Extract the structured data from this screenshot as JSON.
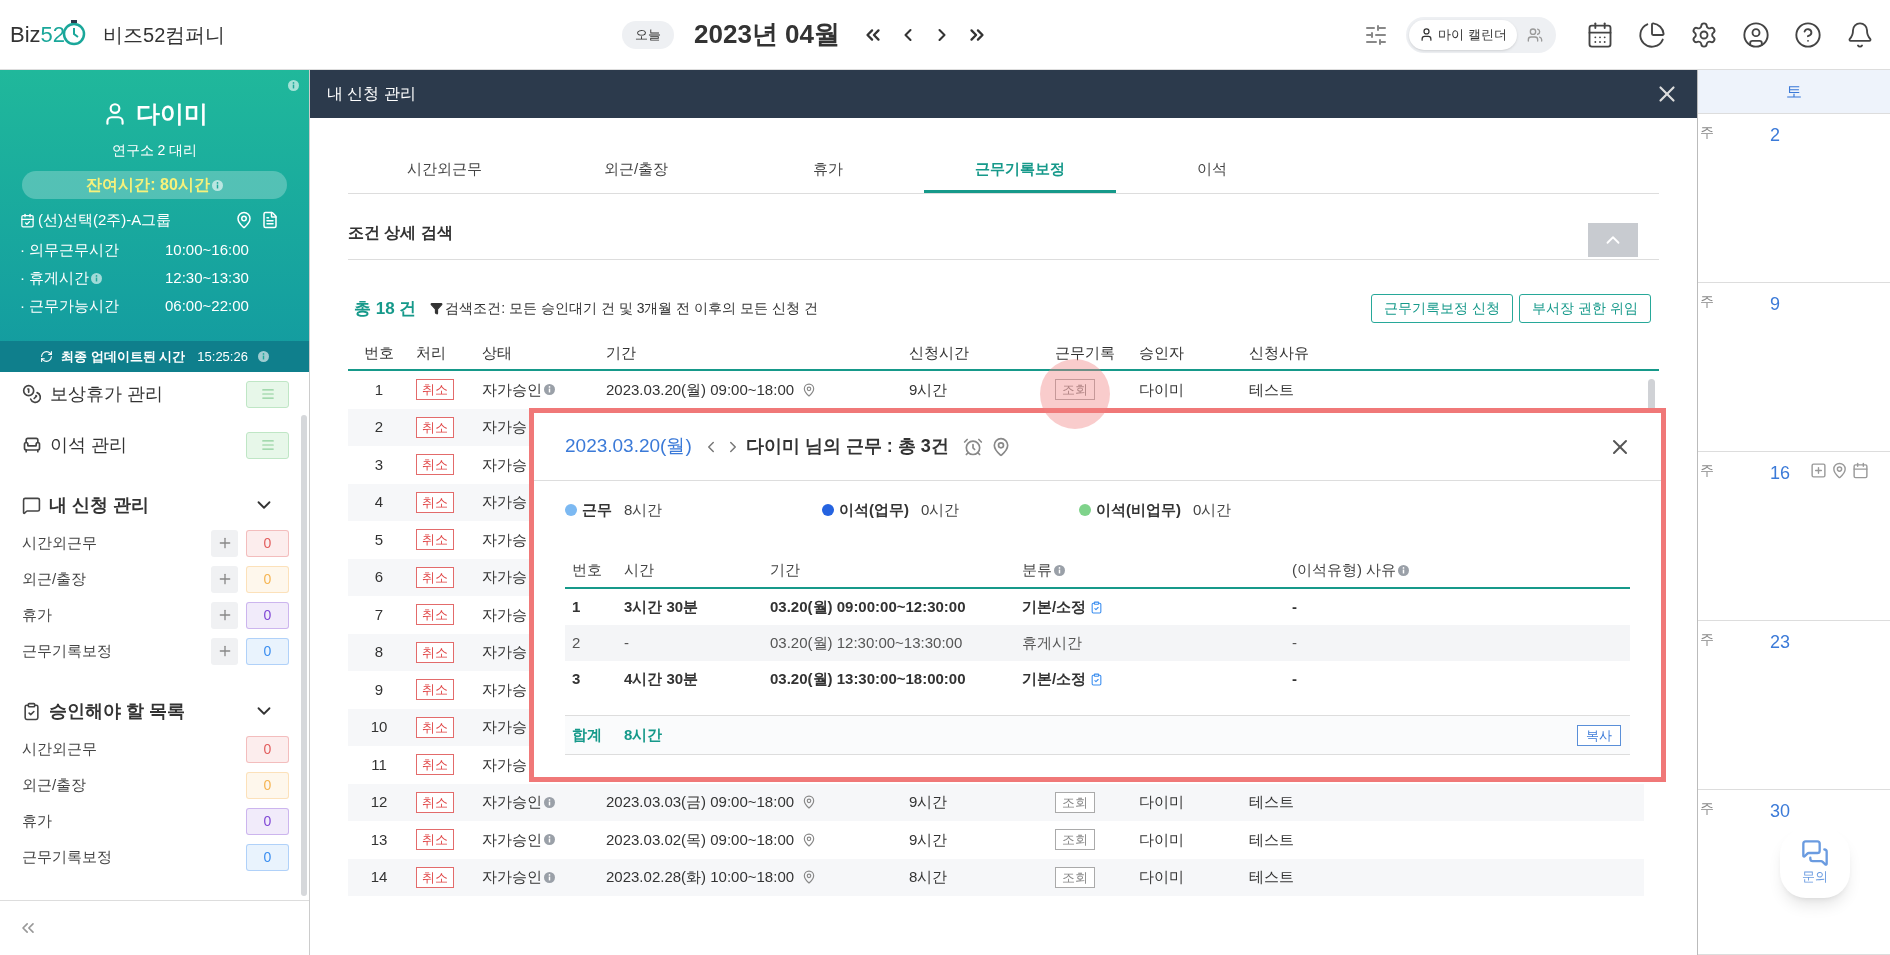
{
  "header": {
    "logo": {
      "prefix": "Biz",
      "suffix": "52"
    },
    "company": "비즈52컴퍼니",
    "today_button": "오늘",
    "month": "2023년 04월",
    "calendar_toggle": {
      "label": "마이 캘린더",
      "selected": true
    }
  },
  "sidebar": {
    "profile": {
      "name": "다이미",
      "position": "연구소 2 대리",
      "remaining": "잔여시간: 80시간",
      "schedule": "(선)선택(2주)-A그룹",
      "times": [
        {
          "label": "· 의무근무시간",
          "value": "10:00~16:00",
          "info": false
        },
        {
          "label": "· 휴게시간",
          "value": "12:30~13:30",
          "info": true
        },
        {
          "label": "· 근무가능시간",
          "value": "06:00~22:00",
          "info": false
        }
      ],
      "updated_label": "최종 업데이트된 시간",
      "updated_time": "15:25:26"
    },
    "menus": [
      {
        "label": "보상휴가 관리",
        "kind": "coins"
      },
      {
        "label": "이석 관리",
        "kind": "seat"
      }
    ],
    "sections": [
      {
        "title": "내 신청 관리",
        "kind": "requests",
        "expanded": true,
        "addable": true,
        "items": [
          {
            "label": "시간외근무",
            "count": "0",
            "color": "#e25c5c"
          },
          {
            "label": "외근/출장",
            "count": "0",
            "color": "#f5b553"
          },
          {
            "label": "휴가",
            "count": "0",
            "color": "#8148d6"
          },
          {
            "label": "근무기록보정",
            "count": "0",
            "color": "#3b8ef0"
          }
        ]
      },
      {
        "title": "승인해야 할 목록",
        "kind": "approvals",
        "expanded": true,
        "addable": false,
        "items": [
          {
            "label": "시간외근무",
            "count": "0",
            "color": "#e25c5c"
          },
          {
            "label": "외근/출장",
            "count": "0",
            "color": "#f5b553"
          },
          {
            "label": "휴가",
            "count": "0",
            "color": "#8148d6"
          },
          {
            "label": "근무기록보정",
            "count": "0",
            "color": "#3b8ef0"
          }
        ]
      }
    ]
  },
  "modal": {
    "title": "내 신청 관리",
    "tabs": [
      {
        "label": "시간외근무",
        "selected": false
      },
      {
        "label": "외근/출장",
        "selected": false
      },
      {
        "label": "휴가",
        "selected": false
      },
      {
        "label": "근무기록보정",
        "selected": true
      },
      {
        "label": "이석",
        "selected": false
      }
    ],
    "search_title": "조건 상세 검색",
    "total": "총 18 건",
    "filter": "검색조건: 모든 승인대기 건 및 3개월 전 이후의 모든 신청 건",
    "buttons": [
      "근무기록보정 신청",
      "부서장 권한 위임"
    ],
    "table": {
      "columns": [
        "번호",
        "처리",
        "상태",
        "기간",
        "신청시간",
        "근무기록",
        "승인자",
        "신청사유"
      ],
      "rows": [
        {
          "no": "1",
          "action": "취소",
          "status": "자가승인",
          "period": "2023.03.20(월) 09:00~18:00",
          "hours": "9시간",
          "record": "조회",
          "approver": "다이미",
          "reason": "테스트"
        },
        {
          "no": "2",
          "action": "취소",
          "status": "자가승"
        },
        {
          "no": "3",
          "action": "취소",
          "status": "자가승"
        },
        {
          "no": "4",
          "action": "취소",
          "status": "자가승"
        },
        {
          "no": "5",
          "action": "취소",
          "status": "자가승"
        },
        {
          "no": "6",
          "action": "취소",
          "status": "자가승"
        },
        {
          "no": "7",
          "action": "취소",
          "status": "자가승"
        },
        {
          "no": "8",
          "action": "취소",
          "status": "자가승"
        },
        {
          "no": "9",
          "action": "취소",
          "status": "자가승"
        },
        {
          "no": "10",
          "action": "취소",
          "status": "자가승"
        },
        {
          "no": "11",
          "action": "취소",
          "status": "자가승"
        },
        {
          "no": "12",
          "action": "취소",
          "status": "자가승인",
          "period": "2023.03.03(금) 09:00~18:00",
          "hours": "9시간",
          "record": "조회",
          "approver": "다이미",
          "reason": "테스트"
        },
        {
          "no": "13",
          "action": "취소",
          "status": "자가승인",
          "period": "2023.03.02(목) 09:00~18:00",
          "hours": "9시간",
          "record": "조회",
          "approver": "다이미",
          "reason": "테스트"
        },
        {
          "no": "14",
          "action": "취소",
          "status": "자가승인",
          "period": "2023.02.28(화) 10:00~18:00",
          "hours": "8시간",
          "record": "조회",
          "approver": "다이미",
          "reason": "테스트"
        }
      ]
    }
  },
  "detail": {
    "date": "2023.03.20(월)",
    "title": "다이미 님의 근무 : 총 3건",
    "legend": [
      {
        "label": "근무",
        "value": "8시간",
        "color": "#7cb9f2"
      },
      {
        "label": "이석(업무)",
        "value": "0시간",
        "color": "#2563e0"
      },
      {
        "label": "이석(비업무)",
        "value": "0시간",
        "color": "#7fd38b"
      }
    ],
    "columns": [
      {
        "label": "번호",
        "info": false
      },
      {
        "label": "시간",
        "info": false
      },
      {
        "label": "기간",
        "info": false
      },
      {
        "label": "분류",
        "info": true
      },
      {
        "label": "(이석유형) 사유",
        "info": true
      }
    ],
    "rows": [
      {
        "kind": "work",
        "no": "1",
        "time": "3시간 30분",
        "period": "03.20(월) 09:00:00~12:30:00",
        "category": "기본/소정",
        "reason": "-"
      },
      {
        "kind": "break",
        "no": "2",
        "time": "-",
        "period": "03.20(월) 12:30:00~13:30:00",
        "category": "휴게시간",
        "reason": "-"
      },
      {
        "kind": "work",
        "no": "3",
        "time": "4시간 30분",
        "period": "03.20(월) 13:30:00~18:00:00",
        "category": "기본/소정",
        "reason": "-"
      }
    ],
    "total_label": "합계",
    "total": "8시간",
    "copy_button": "복사"
  },
  "calendar": {
    "day": "토",
    "weeks": [
      {
        "label": "주",
        "date": "2",
        "actions": false
      },
      {
        "label": "주",
        "date": "9",
        "actions": false
      },
      {
        "label": "주",
        "date": "16",
        "actions": true
      },
      {
        "label": "주",
        "date": "23",
        "actions": false
      },
      {
        "label": "주",
        "date": "30",
        "actions": false
      }
    ]
  },
  "chat_button": "문의"
}
